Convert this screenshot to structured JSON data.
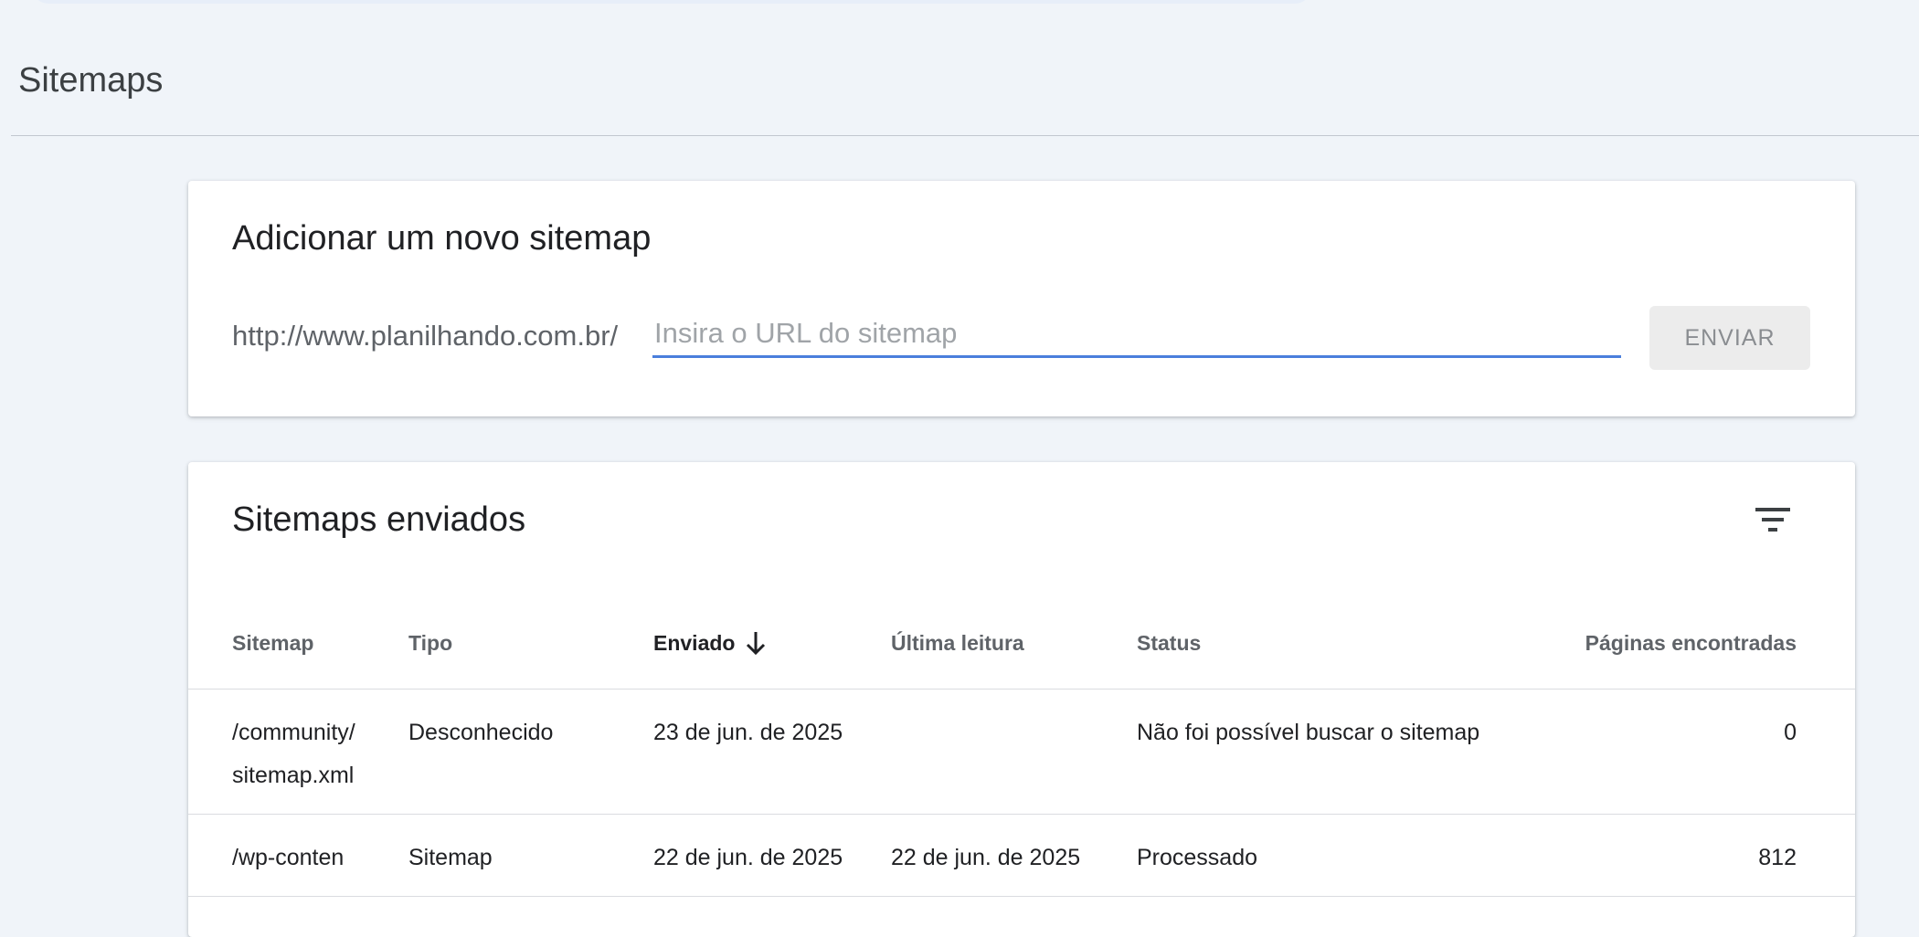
{
  "page": {
    "title": "Sitemaps"
  },
  "add_sitemap": {
    "title": "Adicionar um novo sitemap",
    "url_prefix": "http://www.planilhando.com.br/",
    "input_placeholder": "Insira o URL do sitemap",
    "input_value": "",
    "submit_label": "ENVIAR"
  },
  "sent_sitemaps": {
    "title": "Sitemaps enviados",
    "filter_icon": "filter-icon",
    "sort_icon": "arrow-down-icon",
    "columns": {
      "sitemap": "Sitemap",
      "type": "Tipo",
      "sent": "Enviado",
      "last_read": "Última leitura",
      "status": "Status",
      "pages": "Páginas encontradas"
    },
    "rows": [
      {
        "sitemap": "/community/sitemap.xml",
        "type": "Desconhecido",
        "sent": "23 de jun. de 2025",
        "last_read": "",
        "status": "Não foi possível buscar o sitemap",
        "pages": "0"
      },
      {
        "sitemap": "/wp-conten",
        "type": "Sitemap",
        "sent": "22 de jun. de 2025",
        "last_read": "22 de jun. de 2025",
        "status": "Processado",
        "pages": "812"
      }
    ]
  },
  "colors": {
    "background": "#f0f4f9",
    "input_focus": "#4a7fdc",
    "status_error": "#c5382b",
    "status_ok": "#2f8f46"
  }
}
